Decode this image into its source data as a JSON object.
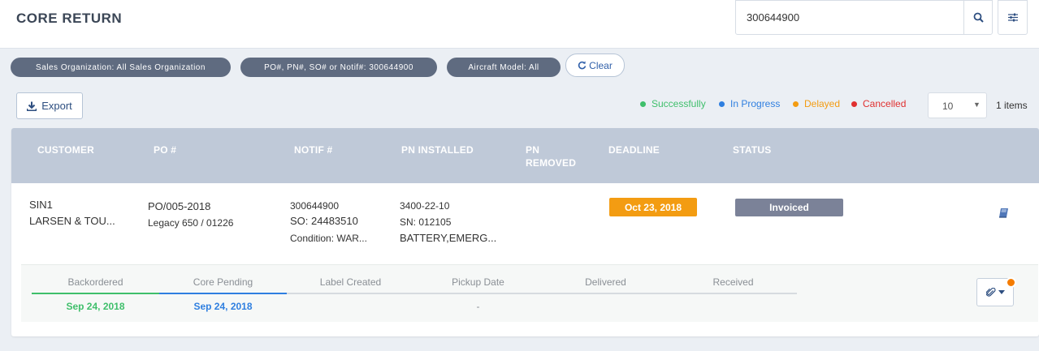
{
  "header": {
    "title": "CORE RETURN",
    "search_value": "300644900"
  },
  "filters": {
    "chips": [
      "Sales Organization: All Sales Organization",
      "PO#, PN#, SO# or Notif#: 300644900",
      "Aircraft Model: All"
    ],
    "clear_label": "Clear"
  },
  "toolbar": {
    "export_label": "Export",
    "page_size": "10",
    "items_count": "1 items"
  },
  "legend": [
    {
      "label": "Successfully",
      "color": "#3fbf6b"
    },
    {
      "label": "In Progress",
      "color": "#2f7fe0"
    },
    {
      "label": "Delayed",
      "color": "#f39c12"
    },
    {
      "label": "Cancelled",
      "color": "#e03030"
    }
  ],
  "table": {
    "columns": [
      "CUSTOMER",
      "PO #",
      "NOTIF #",
      "PN INSTALLED",
      "PN\nREMOVED",
      "DEADLINE",
      "STATUS"
    ],
    "row": {
      "customer_code": "SIN1",
      "customer_name": "LARSEN & TOU...",
      "po": "PO/005-2018",
      "legacy": "Legacy 650 / 01226",
      "notif": "300644900",
      "so": "SO: 24483510",
      "condition": "Condition: WAR...",
      "pn_installed": "3400-22-10",
      "sn": "SN: 012105",
      "description": "BATTERY,EMERG...",
      "deadline": "Oct 23, 2018",
      "status": "Invoiced"
    }
  },
  "tracker": {
    "steps": [
      {
        "label": "Backordered",
        "date": "Sep 24, 2018",
        "color": "#3fbf6b"
      },
      {
        "label": "Core Pending",
        "date": "Sep 24, 2018",
        "color": "#2f7fe0"
      },
      {
        "label": "Label Created",
        "date": "",
        "color": ""
      },
      {
        "label": "Pickup Date",
        "date": "-",
        "color": ""
      },
      {
        "label": "Delivered",
        "date": "",
        "color": ""
      },
      {
        "label": "Received",
        "date": "",
        "color": ""
      }
    ]
  },
  "colors": {
    "accent": "#2f5fa9",
    "chip_bg": "#5f6b80",
    "header_bg": "#bfc9d8",
    "deadline_bg": "#f39c12",
    "status_bg": "#7b8298",
    "notification_dot": "#f57c00"
  },
  "icons": [
    "search-icon",
    "sliders-icon",
    "refresh-icon",
    "download-icon",
    "book-icon",
    "paperclip-icon",
    "caret-down-icon"
  ]
}
